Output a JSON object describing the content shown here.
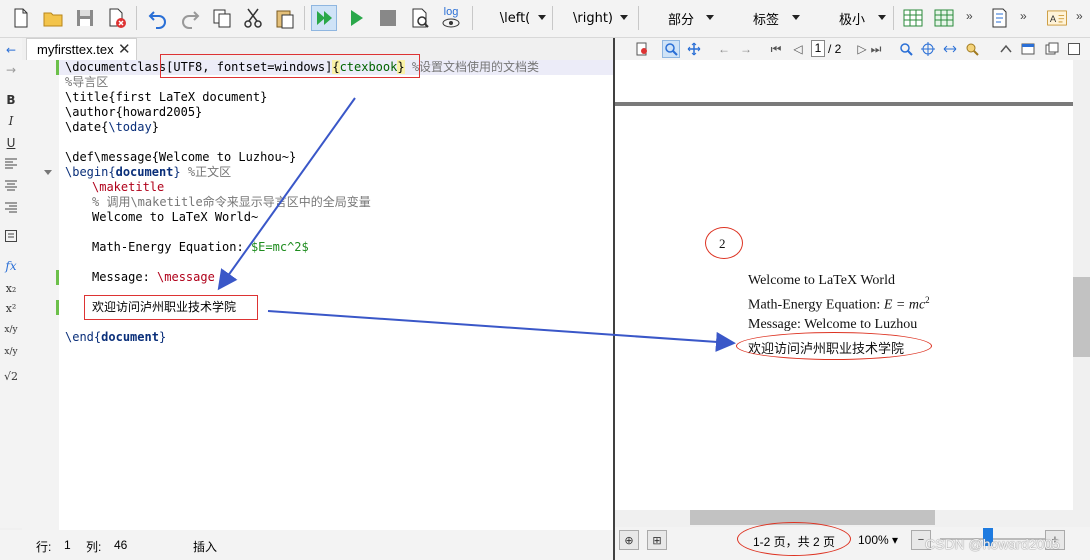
{
  "toolbar": {
    "left_paren": "\\left(",
    "right_paren": "\\right)",
    "section": "部分",
    "label": "标签",
    "size": "极小",
    "log": "log"
  },
  "sidebar": {
    "back": "←",
    "forward": "→",
    "bold": "B",
    "italic": "I",
    "underline": "U",
    "fx": "fx",
    "subscript": "x₂",
    "superscript": "x²",
    "frac1": "x/y",
    "frac2": "x/y",
    "sqrt": "√2"
  },
  "editor": {
    "tab_title": "myfirsttex.tex",
    "tab_close": "✕",
    "lines": {
      "l1_a": "\\documentclass",
      "l1_b": "[UTF8, fontset=windows]",
      "l1_c": "{",
      "l1_d": "ctexbook",
      "l1_e": "}",
      "l1_f": " %设置文档使用的文档类",
      "l2": "%导言区",
      "l3_a": "\\title",
      "l3_b": "{first LaTeX document}",
      "l4_a": "\\author",
      "l4_b": "{howard2005}",
      "l5_a": "\\date",
      "l5_b": "{",
      "l5_c": "\\today",
      "l5_d": "}",
      "l7_a": "\\def\\message",
      "l7_b": "{Welcome to Luzhou~}",
      "l8_a": "\\begin",
      "l8_b": "{",
      "l8_c": "document",
      "l8_d": "}",
      "l8_e": " %正文区",
      "l9": "\\maketitle",
      "l10": "% 调用\\maketitle命令来显示导言区中的全局变量",
      "l11": "Welcome to LaTeX World~",
      "l13_a": "Math-Energy Equation: ",
      "l13_b": "$E=mc^2$",
      "l15_a": "Message: ",
      "l15_b": "\\message",
      "l17": "欢迎访问泸州职业技术学院",
      "l19_a": "\\end",
      "l19_b": "{",
      "l19_c": "document",
      "l19_d": "}"
    }
  },
  "status": {
    "row_label": "行:",
    "row": "1",
    "col_label": "列:",
    "col": "46",
    "mode": "插入"
  },
  "viewer": {
    "page_current": "1",
    "page_total": "/ 2",
    "page_number": "2",
    "text_line1": "Welcome to LaTeX World",
    "text_line2_a": "Math-Energy Equation: ",
    "text_line2_b": "E = mc",
    "text_line2_c": "2",
    "text_line3": "Message: Welcome to Luzhou",
    "text_line4": "欢迎访问泸州职业技术学院",
    "page_info": "1-2 页，共 2 页",
    "zoom": "100%",
    "watermark": "CSDN @howard2005"
  },
  "colors": {
    "annotation_red": "#d33333",
    "arrow_blue": "#3a57c8",
    "accent_blue": "#1e7be0"
  }
}
